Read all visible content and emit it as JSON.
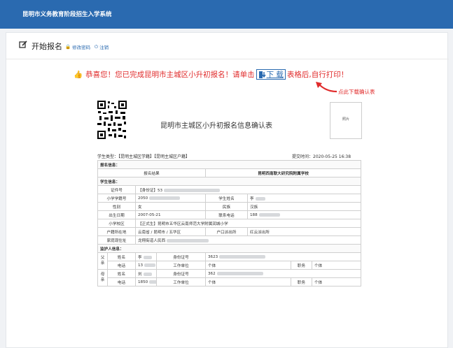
{
  "app": {
    "title": "昆明市义务教育阶段招生入学系统"
  },
  "header": {
    "title": "开始报名",
    "change_pwd": "修改密码",
    "logout": "注销"
  },
  "notice": {
    "before": "恭喜您！您已完成昆明市主城区小升初报名！请单击",
    "download": "下 载",
    "after": "表格后,自行打印！",
    "hint": "点此下载确认表"
  },
  "form": {
    "title": "昆明市主城区小升初报名信息确认表",
    "photo": "照片",
    "student_type": "学生类型：【昆明主城区学籍】【昆明主城区户籍】",
    "submit_time": "提交时间：2020-05-25 16:38",
    "sec_apply": "报名信息：",
    "result_label": "报名结果",
    "result_value": "昆明西南联大研究院附属学校",
    "sec_student": "学生信息：",
    "id_label": "证件号",
    "id_value": "【身份证】53",
    "stuno_label": "小学学籍号",
    "stuno_value": "2050",
    "name_label": "学生姓名",
    "name_value": "李",
    "gender_label": "性别",
    "gender_value": "女",
    "nation_label": "民族",
    "nation_value": "汉族",
    "birth_label": "出生日期",
    "birth_value": "2007-05-21",
    "phone_label": "联系电话",
    "phone_value": "188",
    "school_label": "小学校区",
    "school_value": "【正式生】昆明市五华区云南师范大学附属润城小学",
    "hukou_label": "户籍所在地",
    "hukou_value": "云南省 / 昆明市 / 五华区",
    "police_label": "户口派出所",
    "police_value": "红云派出所",
    "addr_label": "家庭现住址",
    "addr_value": "龙翔街道人民西",
    "sec_guardian": "监护人信息：",
    "father": "父亲",
    "mother": "母亲",
    "g_name_label": "姓名",
    "g_phone_label": "电话",
    "g_id_label": "身份证号",
    "g_work_label": "工作单位",
    "g_duty_label": "职务",
    "f_name": "李",
    "f_phone": "13",
    "f_id": "3623",
    "f_work": "个体",
    "f_duty": "个体",
    "m_name": "刘",
    "m_phone": "1850",
    "m_id": "362",
    "m_work": "个体",
    "m_duty": "个体"
  }
}
